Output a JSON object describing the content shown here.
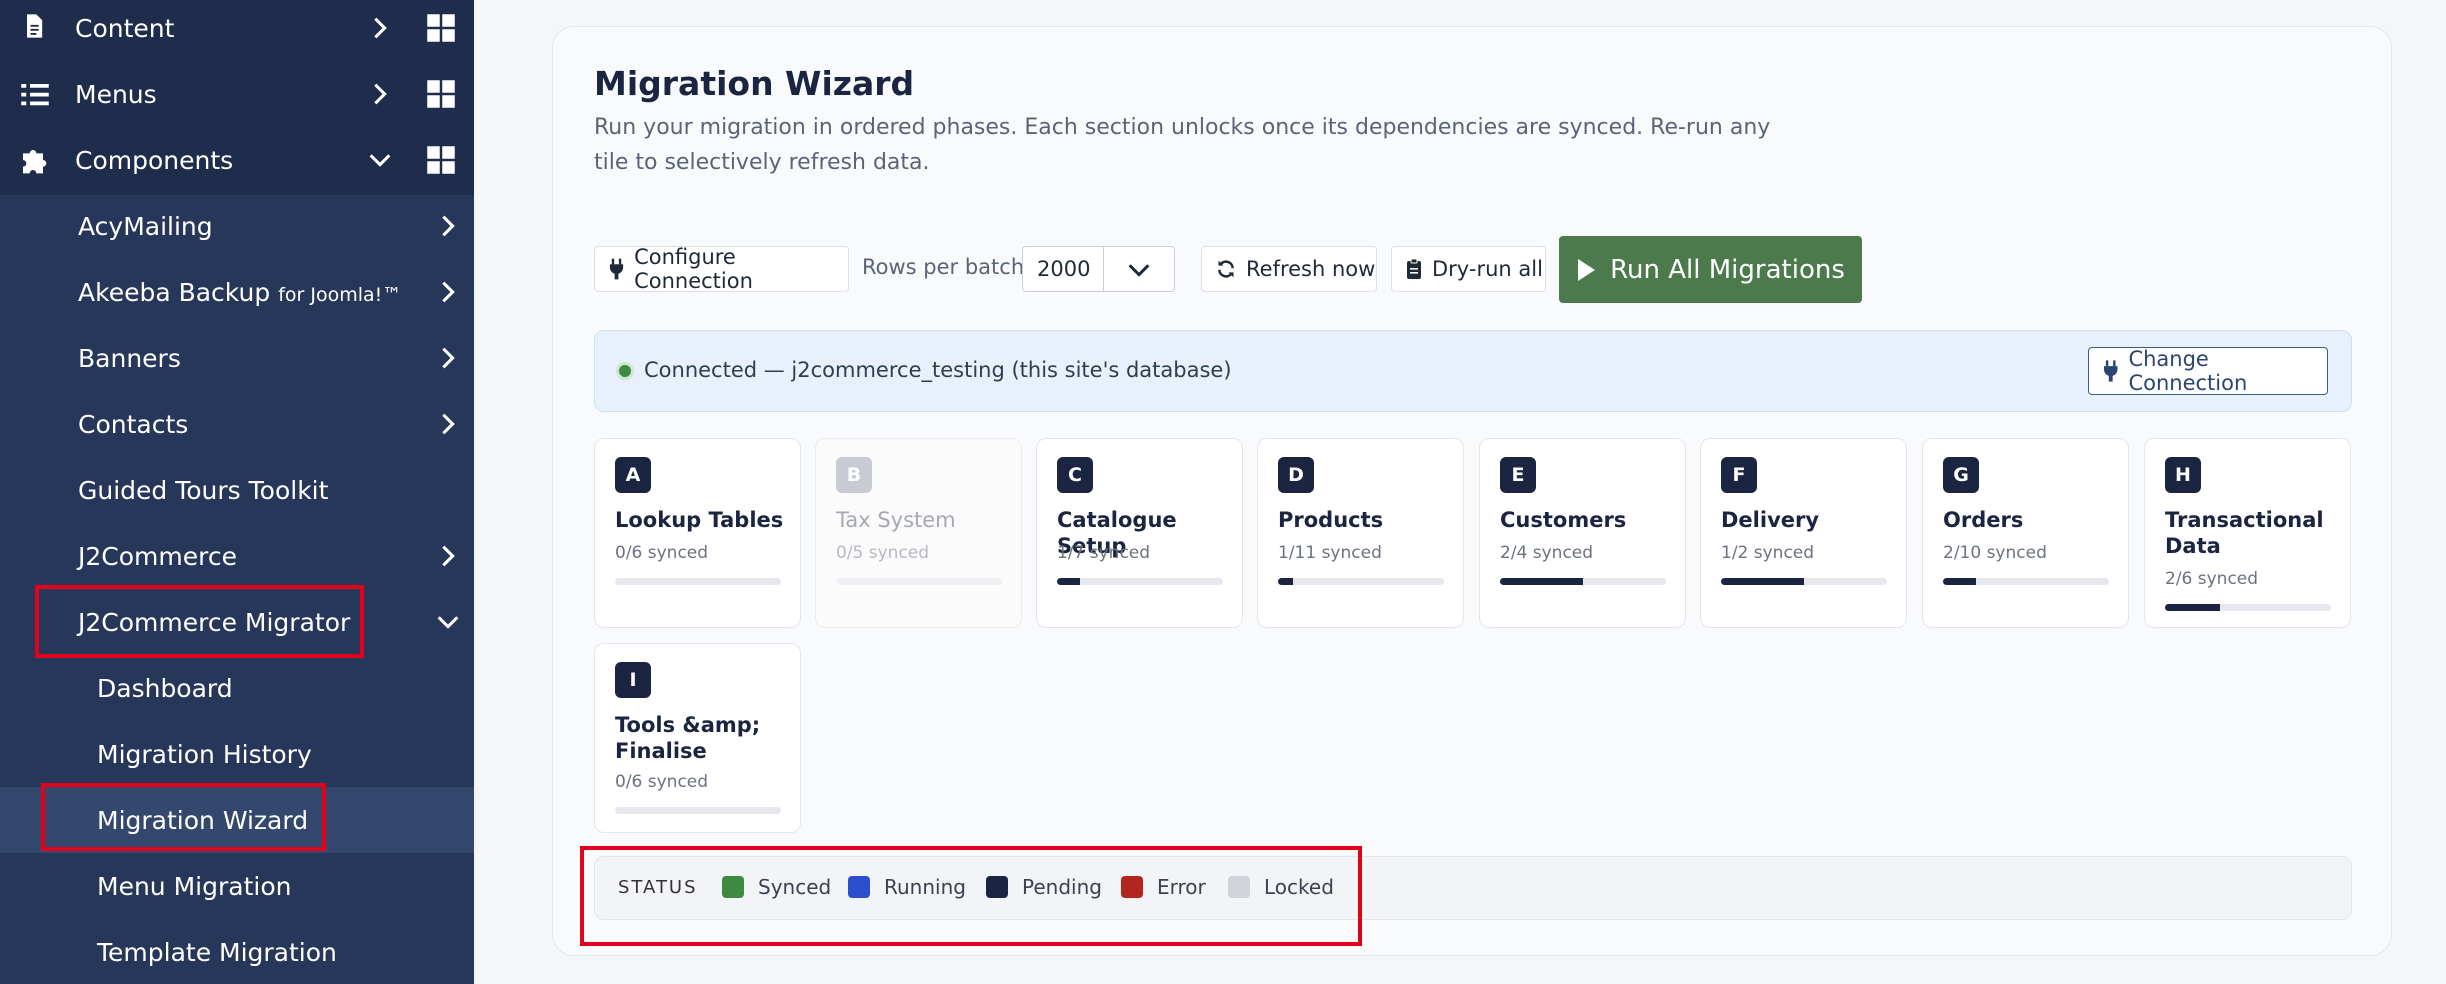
{
  "sidebar": {
    "top_items": [
      {
        "label": "Content",
        "icon": "document-icon"
      },
      {
        "label": "Menus",
        "icon": "list-icon"
      },
      {
        "label": "Components",
        "icon": "puzzle-icon"
      }
    ],
    "components": [
      {
        "label": "AcyMailing"
      },
      {
        "label": "Akeeba Backup",
        "suffix": "for Joomla!™"
      },
      {
        "label": "Banners"
      },
      {
        "label": "Contacts"
      },
      {
        "label": "Guided Tours Toolkit"
      },
      {
        "label": "J2Commerce"
      },
      {
        "label": "J2Commerce Migrator"
      }
    ],
    "migrator_items": [
      {
        "label": "Dashboard"
      },
      {
        "label": "Migration History"
      },
      {
        "label": "Migration Wizard"
      },
      {
        "label": "Menu Migration"
      },
      {
        "label": "Template Migration"
      }
    ]
  },
  "main": {
    "title": "Migration Wizard",
    "description": "Run your migration in ordered phases. Each section unlocks once its dependencies are synced. Re-run any tile to selectively refresh data.",
    "toolbar": {
      "configure_label": "Configure Connection",
      "rows_label": "Rows per batch:",
      "rows_value": "2000",
      "refresh_label": "Refresh now",
      "dryrun_label": "Dry-run all",
      "run_all_label": "Run All Migrations"
    },
    "connection": {
      "text": "Connected — j2commerce_testing (this site's database)",
      "change_label": "Change Connection"
    },
    "tiles": [
      {
        "letter": "A",
        "name": "Lookup Tables",
        "count": "0/6 synced",
        "progress": 0,
        "locked": false
      },
      {
        "letter": "B",
        "name": "Tax System",
        "count": "0/5 synced",
        "progress": 0,
        "locked": true
      },
      {
        "letter": "C",
        "name": "Catalogue Setup",
        "count": "1/7 synced",
        "progress": 0.14,
        "locked": false
      },
      {
        "letter": "D",
        "name": "Products",
        "count": "1/11 synced",
        "progress": 0.09,
        "locked": false
      },
      {
        "letter": "E",
        "name": "Customers",
        "count": "2/4 synced",
        "progress": 0.5,
        "locked": false
      },
      {
        "letter": "F",
        "name": "Delivery",
        "count": "1/2 synced",
        "progress": 0.5,
        "locked": false
      },
      {
        "letter": "G",
        "name": "Orders",
        "count": "2/10 synced",
        "progress": 0.2,
        "locked": false
      },
      {
        "letter": "H",
        "name": "Transactional Data",
        "count": "2/6 synced",
        "progress": 0.33,
        "locked": false
      },
      {
        "letter": "I",
        "name": "Tools &amp; Finalise",
        "count": "0/6 synced",
        "progress": 0,
        "locked": false
      }
    ],
    "status": {
      "title": "STATUS",
      "legend": [
        {
          "label": "Synced",
          "color": "#3d8b40"
        },
        {
          "label": "Running",
          "color": "#2c4fd0"
        },
        {
          "label": "Pending",
          "color": "#1b2440"
        },
        {
          "label": "Error",
          "color": "#b3261e"
        },
        {
          "label": "Locked",
          "color": "#d1d4da"
        }
      ]
    }
  }
}
